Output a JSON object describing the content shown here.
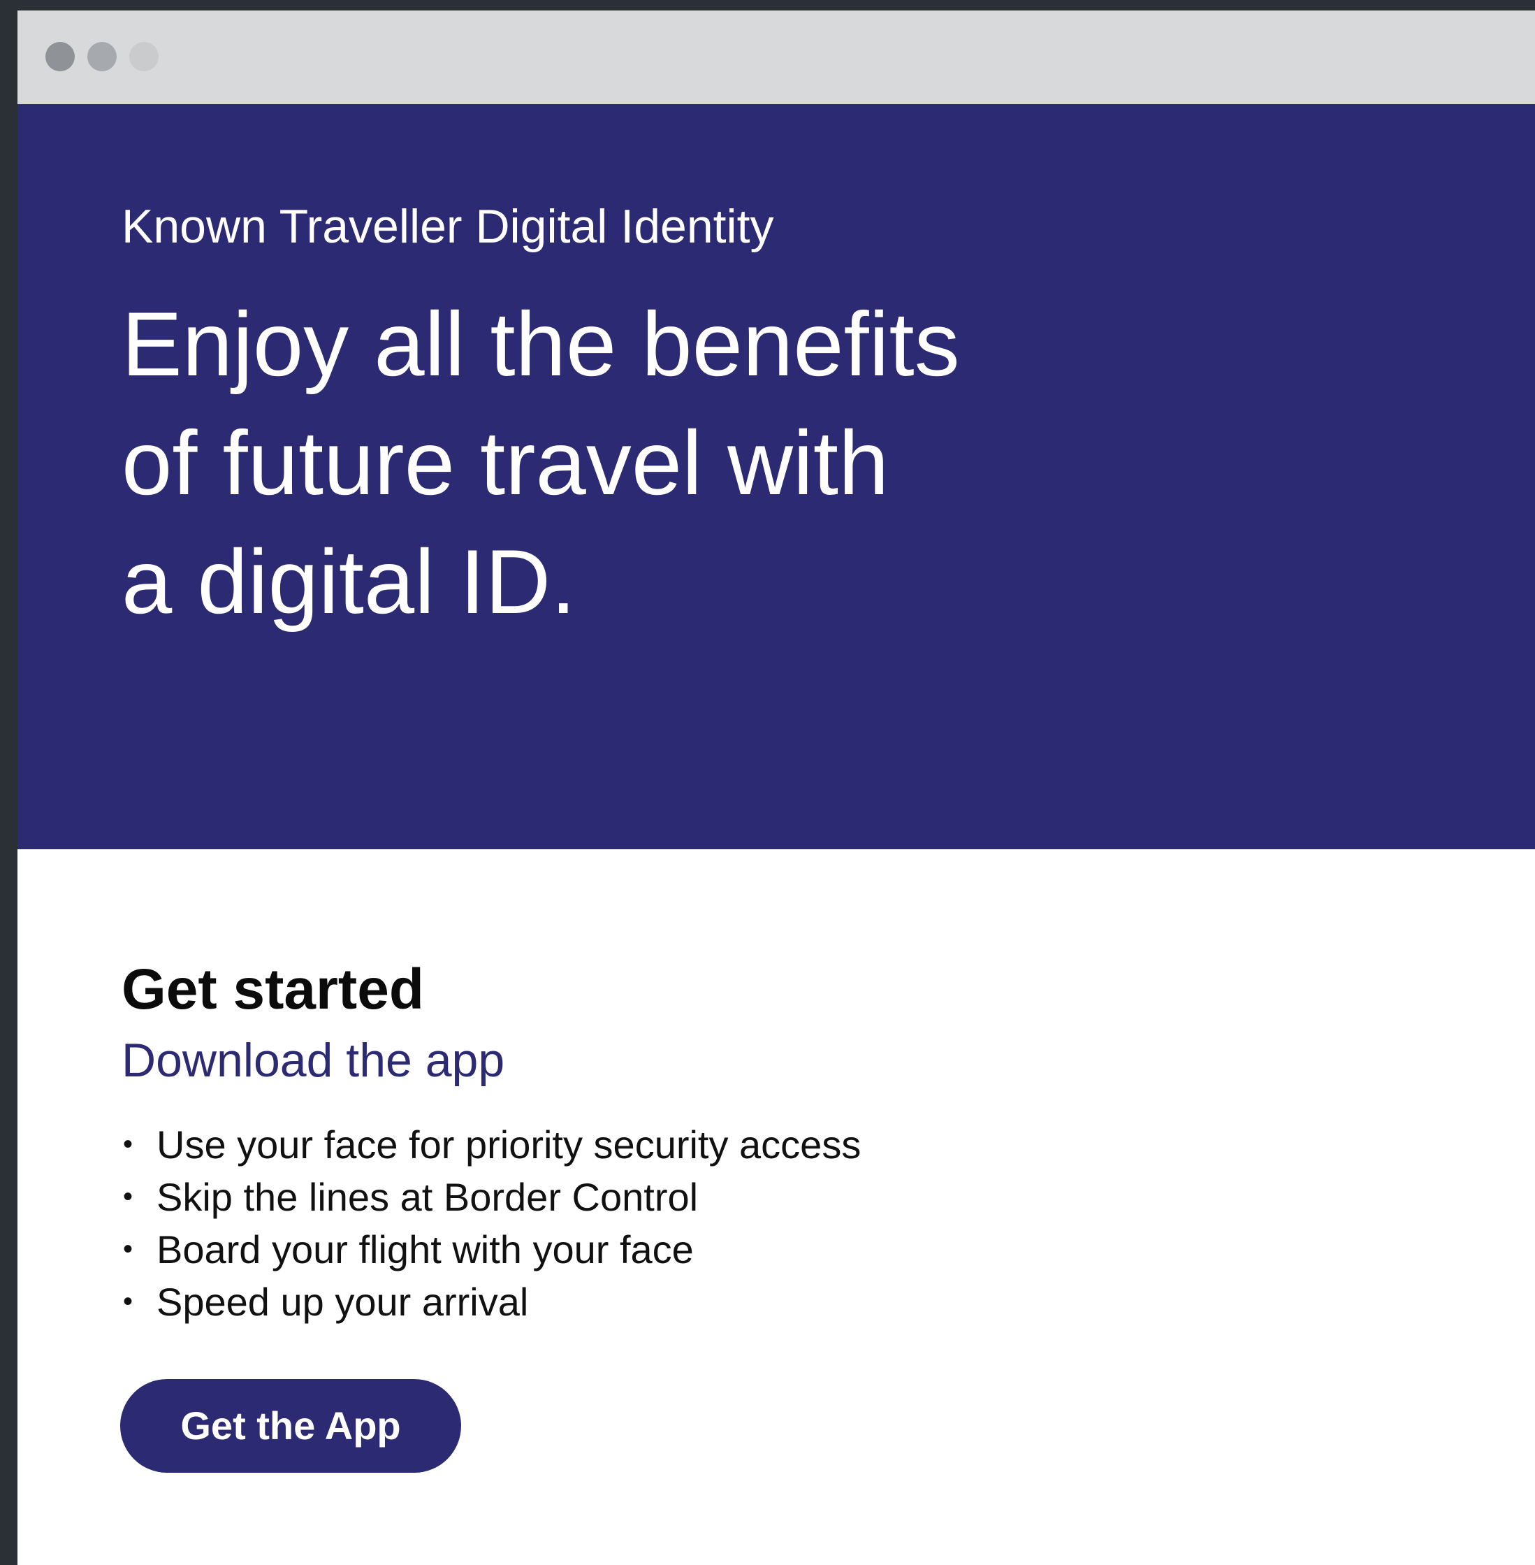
{
  "hero": {
    "kicker": "Known Traveller Digital Identity",
    "headline_lines": [
      "Enjoy all the benefits",
      "of future travel with",
      "a digital ID."
    ]
  },
  "content": {
    "title": "Get started",
    "link": "Download the app",
    "benefits": [
      "Use your face for priority security access",
      "Skip the lines at Border Control",
      "Board your flight with your face",
      "Speed up your arrival"
    ],
    "cta_label": "Get the App"
  },
  "colors": {
    "brand": "#2c2a72",
    "titlebar": "#d8d9da",
    "frame": "#2b3036"
  }
}
